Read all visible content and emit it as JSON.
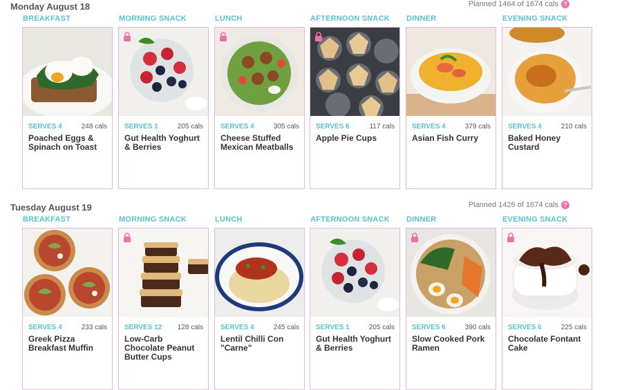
{
  "days": [
    {
      "title": "Monday August 18",
      "planned": "Planned 1464 of 1674 cals",
      "meals": [
        {
          "slot": "BREAKFAST",
          "serves": "SERVES 4",
          "cals": "248 cals",
          "name": "Poached Eggs & Spinach on Toast",
          "locked": false
        },
        {
          "slot": "MORNING SNACK",
          "serves": "SERVES 1",
          "cals": "205 cals",
          "name": "Gut Health Yoghurt & Berries",
          "locked": true
        },
        {
          "slot": "LUNCH",
          "serves": "SERVES 4",
          "cals": "305 cals",
          "name": "Cheese Stuffed Mexican Meatballs",
          "locked": true
        },
        {
          "slot": "AFTERNOON SNACK",
          "serves": "SERVES 6",
          "cals": "117 cals",
          "name": "Apple Pie Cups",
          "locked": true
        },
        {
          "slot": "DINNER",
          "serves": "SERVES 4",
          "cals": "379 cals",
          "name": "Asian Fish Curry",
          "locked": false
        },
        {
          "slot": "EVENING SNACK",
          "serves": "SERVES 4",
          "cals": "210 cals",
          "name": "Baked Honey Custard",
          "locked": false
        }
      ]
    },
    {
      "title": "Tuesday August 19",
      "planned": "Planned 1426 of 1674 cals",
      "meals": [
        {
          "slot": "BREAKFAST",
          "serves": "SERVES 4",
          "cals": "233 cals",
          "name": "Greek Pizza Breakfast Muffin",
          "locked": false
        },
        {
          "slot": "MORNING SNACK",
          "serves": "SERVES 12",
          "cals": "128 cals",
          "name": "Low-Carb Chocolate Peanut Butter Cups",
          "locked": true
        },
        {
          "slot": "LUNCH",
          "serves": "SERVES 4",
          "cals": "245 cals",
          "name": "Lentil Chilli Con \"Carne\"",
          "locked": false
        },
        {
          "slot": "AFTERNOON SNACK",
          "serves": "SERVES 1",
          "cals": "205 cals",
          "name": "Gut Health Yoghurt & Berries",
          "locked": false
        },
        {
          "slot": "DINNER",
          "serves": "SERVES 6",
          "cals": "390 cals",
          "name": "Slow Cooked Pork Ramen",
          "locked": true
        },
        {
          "slot": "EVENING SNACK",
          "serves": "SERVES 6",
          "cals": "225 cals",
          "name": "Chocolate Fontant Cake",
          "locked": true
        }
      ]
    }
  ],
  "colors": {
    "slot_label": "#5bc0cf",
    "card_border": "#e3b8d2",
    "lock": "#f06ea9"
  }
}
